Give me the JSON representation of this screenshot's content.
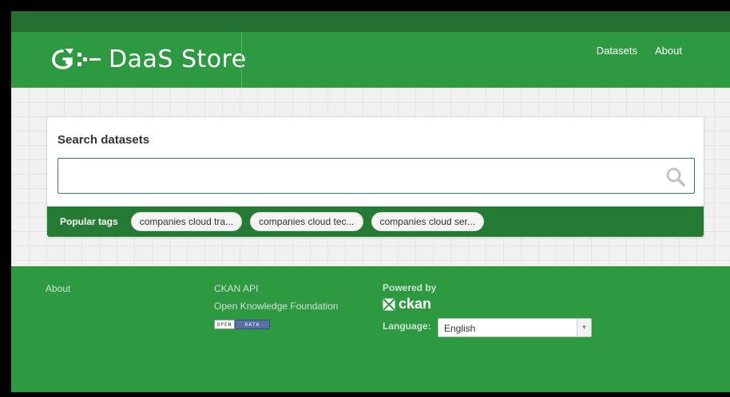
{
  "header": {
    "logo_text": "DaaS Store",
    "nav": [
      {
        "label": "Datasets"
      },
      {
        "label": "About"
      }
    ]
  },
  "search": {
    "title": "Search datasets",
    "value": "",
    "placeholder": "",
    "icon": "search-icon"
  },
  "tags": {
    "label": "Popular tags",
    "items": [
      {
        "label": "companies cloud tra..."
      },
      {
        "label": "companies cloud tec..."
      },
      {
        "label": "companies cloud ser..."
      }
    ]
  },
  "footer": {
    "about": "About",
    "ckan_api": "CKAN API",
    "okf": "Open Knowledge Foundation",
    "open_data_badge": {
      "left": "OPEN",
      "right": "DATA"
    },
    "powered_by": "Powered by",
    "ckan_logo_text": "ckan",
    "language_label": "Language:",
    "language_value": "English"
  },
  "colors": {
    "brand_green": "#2d9a41",
    "dark_green": "#257a34",
    "search_border": "#3a6fa5"
  }
}
